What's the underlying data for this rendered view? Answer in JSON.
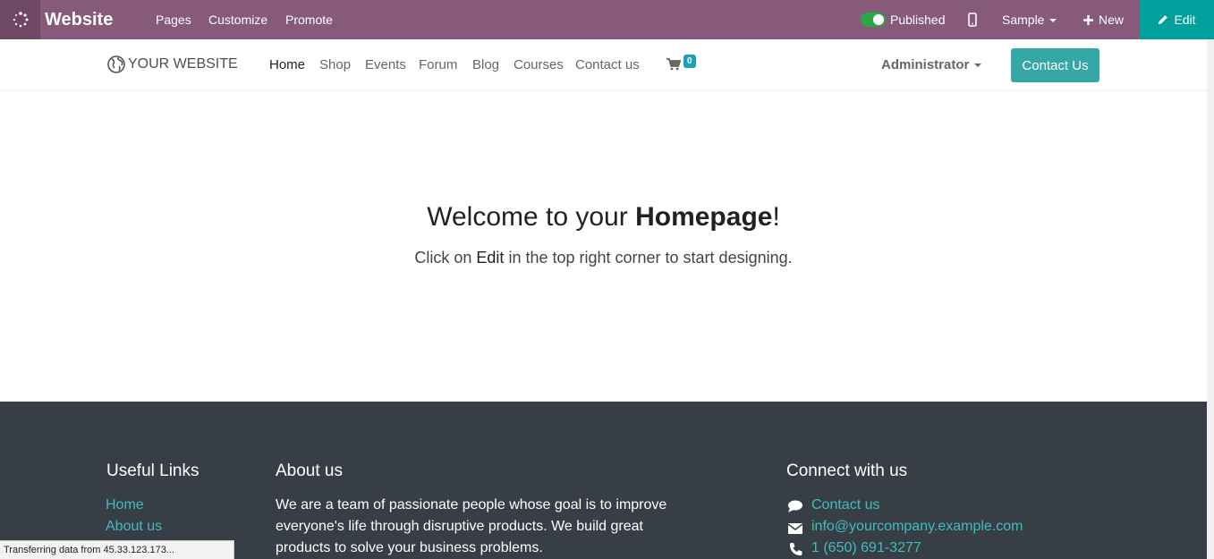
{
  "topbar": {
    "brand": "Website",
    "menu": [
      "Pages",
      "Customize",
      "Promote"
    ],
    "published_label": "Published",
    "published": true,
    "sample_label": "Sample",
    "new_label": "New",
    "edit_label": "Edit",
    "colors": {
      "bar": "#875a7b",
      "apps": "#6e4864",
      "edit": "#00a09d",
      "toggle": "#28a745"
    }
  },
  "navbar": {
    "logo_text": "YOUR WEBSITE",
    "links": [
      "Home",
      "Shop",
      "Events",
      "Forum",
      "Blog",
      "Courses",
      "Contact us"
    ],
    "active_link": "Home",
    "cart_count": "0",
    "user": "Administrator",
    "cta": "Contact Us"
  },
  "hero": {
    "title_prefix": "Welcome to your ",
    "title_bold": "Homepage",
    "title_suffix": "!",
    "sub_prefix": "Click on ",
    "sub_bold": "Edit",
    "sub_suffix": " in the top right corner to start designing."
  },
  "footer": {
    "useful_links_title": "Useful Links",
    "useful_links": [
      "Home",
      "About us"
    ],
    "about_title": "About us",
    "about_lines": [
      "We are a team of passionate people whose goal is to improve",
      "everyone's life through disruptive products. We build great",
      "products to solve your business problems."
    ],
    "connect_title": "Connect with us",
    "contact_items": [
      {
        "icon": "comment-icon",
        "text": "Contact us"
      },
      {
        "icon": "envelope-icon",
        "text": "info@yourcompany.example.com"
      },
      {
        "icon": "phone-icon",
        "text": "1 (650) 691-3277"
      }
    ],
    "colors": {
      "background": "#383e45",
      "link": "#3fbebd"
    }
  },
  "status_bar": "Transferring data from 45.33.123.173..."
}
